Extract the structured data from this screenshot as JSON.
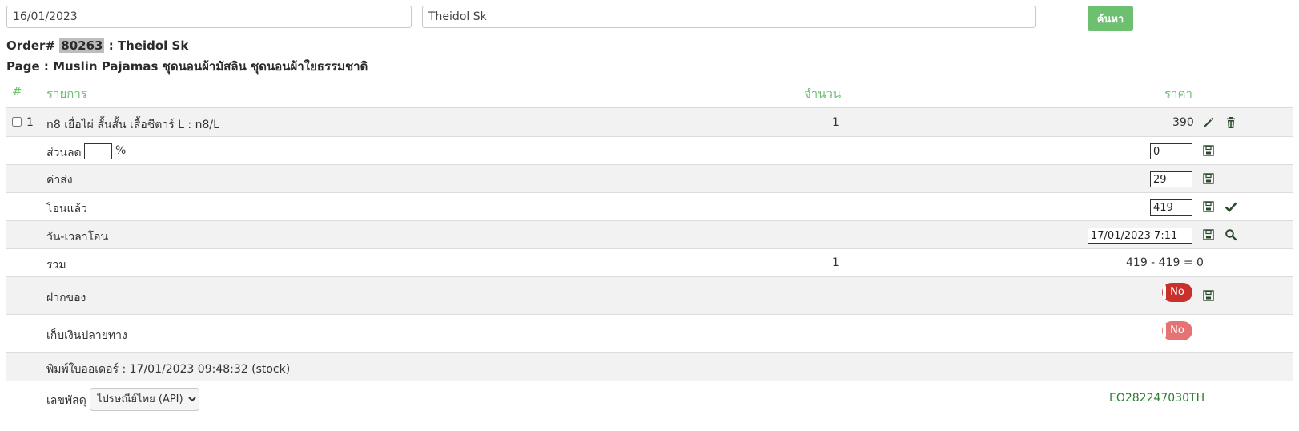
{
  "search": {
    "date_value": "16/01/2023",
    "name_value": "Theidol Sk",
    "button_label": "ค้นหา"
  },
  "order": {
    "prefix": "Order#",
    "number": "80263",
    "customer": ": Theidol Sk",
    "page_line": "Page : Muslin Pajamas ชุดนอนผ้ามัสลิน ชุดนอนผ้าใยธรรมชาติ"
  },
  "table": {
    "headers": {
      "num": "#",
      "item": "รายการ",
      "qty": "จำนวน",
      "price": "ราคา"
    },
    "items": [
      {
        "index": "1",
        "name": "n8 เยื่อไผ่ สั้นสั้น เสื้อชีตาร์ L : n8/L",
        "qty": "1",
        "price": "390"
      }
    ]
  },
  "discount": {
    "label": "ส่วนลด",
    "percent_value": "",
    "percent_sign": "%",
    "amount_value": "0"
  },
  "shipping": {
    "label": "ค่าส่ง",
    "value": "29"
  },
  "transferred": {
    "label": "โอนแล้ว",
    "value": "419"
  },
  "transfer_datetime": {
    "label": "วัน-เวลาโอน",
    "value": "17/01/2023 7:11"
  },
  "total": {
    "label": "รวม",
    "qty": "1",
    "summary": "419 - 419 = 0"
  },
  "deposit": {
    "label": "ฝากของ",
    "toggle": "No"
  },
  "cod": {
    "label": "เก็บเงินปลายทาง",
    "toggle": "No"
  },
  "print": {
    "label": "พิมพ์ใบออเดอร์ : 17/01/2023 09:48:32 (stock)"
  },
  "parcel": {
    "label": "เลขพัสดุ",
    "carrier_selected": "ไปรษณีย์ไทย (API)",
    "tracking": "EO282247030TH"
  },
  "colors": {
    "accent_green": "#6cc070",
    "tracking_green": "#2e7d32",
    "toggle_red": "#c9302c",
    "toggle_light_red": "#e57373",
    "row_shade": "#f2f2f2"
  }
}
